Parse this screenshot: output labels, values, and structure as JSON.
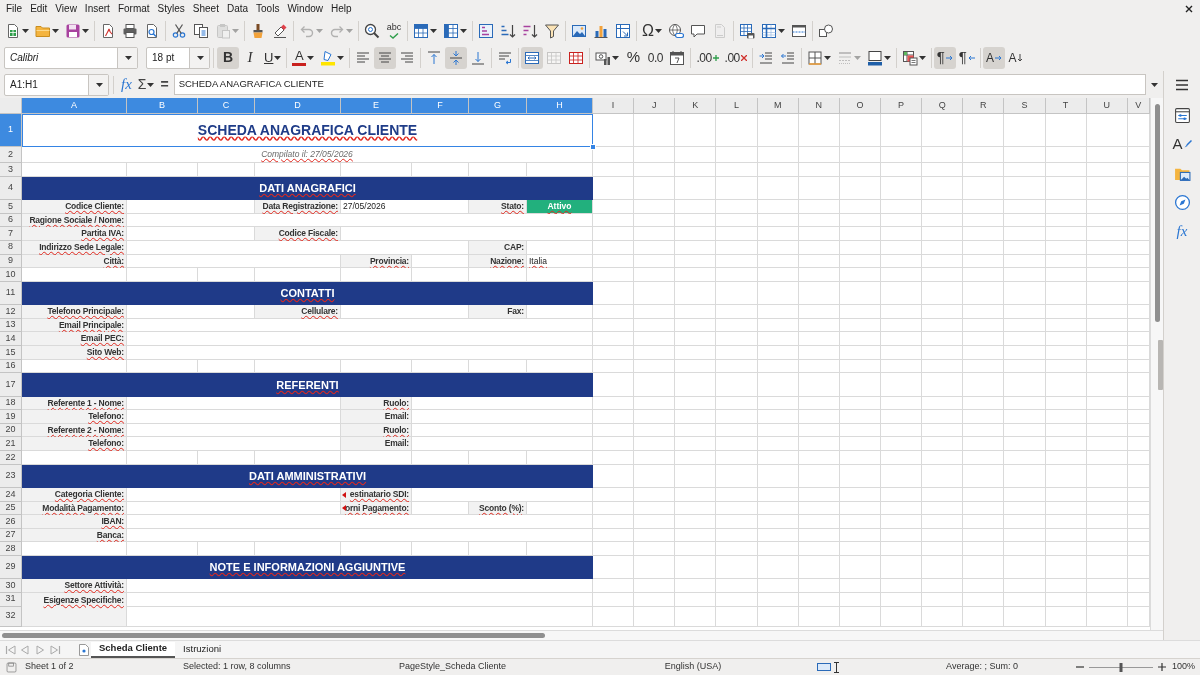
{
  "menu_bar": {
    "items": [
      "File",
      "Edit",
      "View",
      "Insert",
      "Format",
      "Styles",
      "Sheet",
      "Data",
      "Tools",
      "Window",
      "Help"
    ]
  },
  "standard_toolbar": {
    "groups": [
      [
        {
          "kind": "new",
          "disabled": false
        },
        {
          "kind": "open",
          "disabled": false
        },
        {
          "kind": "save",
          "disabled": false
        }
      ],
      [
        {
          "kind": "export_pdf",
          "disabled": false
        },
        {
          "kind": "print",
          "disabled": false
        },
        {
          "kind": "print_preview",
          "disabled": false
        }
      ],
      [
        {
          "kind": "cut",
          "disabled": false
        },
        {
          "kind": "copy",
          "disabled": false
        },
        {
          "kind": "paste",
          "disabled": true
        }
      ],
      [
        {
          "kind": "clone_formatting",
          "disabled": false
        },
        {
          "kind": "clear_formatting",
          "disabled": false
        }
      ],
      [
        {
          "kind": "undo",
          "disabled": true
        },
        {
          "kind": "redo",
          "disabled": true
        }
      ],
      [
        {
          "kind": "find_replace",
          "disabled": false
        },
        {
          "kind": "spelling",
          "glyph": "abc",
          "disabled": false
        }
      ],
      [
        {
          "kind": "rows",
          "disabled": false
        },
        {
          "kind": "columns",
          "disabled": false
        }
      ],
      [
        {
          "kind": "sort",
          "disabled": false
        },
        {
          "kind": "sort_ascending",
          "disabled": false
        },
        {
          "kind": "sort_descending",
          "disabled": false
        },
        {
          "kind": "autofilter",
          "disabled": false
        }
      ],
      [
        {
          "kind": "image",
          "disabled": false
        },
        {
          "kind": "chart",
          "disabled": false
        },
        {
          "kind": "pivot_table",
          "disabled": false
        }
      ],
      [
        {
          "kind": "special_character",
          "glyph": "Ω",
          "disabled": false
        },
        {
          "kind": "hyperlink",
          "disabled": false
        },
        {
          "kind": "comment",
          "disabled": false
        },
        {
          "kind": "headers_footers",
          "disabled": true
        }
      ],
      [
        {
          "kind": "print_area",
          "disabled": false
        },
        {
          "kind": "freeze",
          "disabled": false
        },
        {
          "kind": "split",
          "disabled": false
        }
      ],
      [
        {
          "kind": "draw",
          "disabled": false
        }
      ]
    ]
  },
  "formatting_toolbar": {
    "font_name": "Calibri",
    "font_size": "18 pt",
    "groups": [
      [
        {
          "kind": "bold",
          "glyph": "B",
          "on": true,
          "disabled": false
        },
        {
          "kind": "italic",
          "glyph": "I",
          "on": false,
          "disabled": false
        },
        {
          "kind": "underline",
          "glyph": "U",
          "on": false,
          "disabled": false
        }
      ],
      [
        {
          "kind": "font_color",
          "glyph": "A",
          "on": false,
          "disabled": false
        },
        {
          "kind": "highlight",
          "on": false,
          "disabled": false
        }
      ],
      [
        {
          "kind": "align_left",
          "on": false,
          "disabled": false
        },
        {
          "kind": "align_center",
          "on": true,
          "disabled": false
        },
        {
          "kind": "align_right",
          "on": false,
          "disabled": false
        }
      ],
      [
        {
          "kind": "align_top",
          "on": false,
          "disabled": false
        },
        {
          "kind": "align_middle",
          "on": true,
          "disabled": false
        },
        {
          "kind": "align_bottom",
          "on": false,
          "disabled": false
        }
      ],
      [
        {
          "kind": "wrap",
          "on": false,
          "disabled": false
        }
      ],
      [
        {
          "kind": "merge_center",
          "on": true,
          "disabled": false
        },
        {
          "kind": "merge",
          "on": false,
          "disabled": true
        },
        {
          "kind": "unmerge",
          "on": false,
          "disabled": false
        }
      ],
      [
        {
          "kind": "number_format",
          "on": false,
          "disabled": false
        },
        {
          "kind": "percent",
          "glyph": "%",
          "on": false,
          "disabled": false
        },
        {
          "kind": "number",
          "glyph": "0.0",
          "on": false,
          "disabled": false
        },
        {
          "kind": "date",
          "on": false,
          "disabled": false
        }
      ],
      [
        {
          "kind": "add_decimal",
          "glyph": ".00",
          "on": false,
          "disabled": false
        },
        {
          "kind": "delete_decimal",
          "glyph": ".00",
          "on": false,
          "disabled": false
        }
      ],
      [
        {
          "kind": "indent_increase",
          "on": false,
          "disabled": false
        },
        {
          "kind": "indent_decrease",
          "on": false,
          "disabled": false
        }
      ],
      [
        {
          "kind": "borders",
          "on": false,
          "disabled": false
        },
        {
          "kind": "border_style",
          "on": false,
          "disabled": true
        },
        {
          "kind": "border_color",
          "on": false,
          "disabled": false
        }
      ],
      [
        {
          "kind": "conditional",
          "on": false,
          "disabled": false
        }
      ],
      [
        {
          "kind": "paragraph_ltr",
          "glyph": "¶",
          "on": true,
          "disabled": false
        },
        {
          "kind": "paragraph_rtl",
          "glyph": "¶",
          "on": false,
          "disabled": false
        }
      ],
      [
        {
          "kind": "text_ltr",
          "glyph": "A",
          "on": true,
          "disabled": false
        },
        {
          "kind": "text_ttb",
          "glyph": "A",
          "on": false,
          "disabled": false
        }
      ]
    ]
  },
  "formula_bar": {
    "name_box": "A1:H1",
    "function_wizard": "fx",
    "sum": "Σ",
    "equals": "=",
    "content": "SCHEDA ANAGRAFICA CLIENTE"
  },
  "sidebar": {
    "tabs": [
      {
        "kind": "properties",
        "selected": false
      },
      {
        "kind": "styles",
        "glyph": "A",
        "selected": false
      },
      {
        "kind": "gallery",
        "selected": false
      },
      {
        "kind": "navigator",
        "selected": false
      },
      {
        "kind": "functions",
        "glyph": "fx",
        "selected": false
      }
    ]
  },
  "sheet": {
    "columns": [
      {
        "label": "A",
        "selected": true
      },
      {
        "label": "B",
        "selected": true
      },
      {
        "label": "C",
        "selected": true
      },
      {
        "label": "D",
        "selected": true
      },
      {
        "label": "E",
        "selected": true
      },
      {
        "label": "F",
        "selected": true
      },
      {
        "label": "G",
        "selected": true
      },
      {
        "label": "H",
        "selected": true
      },
      {
        "label": "I",
        "selected": false
      },
      {
        "label": "J",
        "selected": false
      },
      {
        "label": "K",
        "selected": false
      },
      {
        "label": "L",
        "selected": false
      },
      {
        "label": "M",
        "selected": false
      },
      {
        "label": "N",
        "selected": false
      },
      {
        "label": "O",
        "selected": false
      },
      {
        "label": "P",
        "selected": false
      },
      {
        "label": "Q",
        "selected": false
      },
      {
        "label": "R",
        "selected": false
      },
      {
        "label": "S",
        "selected": false
      },
      {
        "label": "T",
        "selected": false
      },
      {
        "label": "U",
        "selected": false
      },
      {
        "label": "V",
        "selected": false
      }
    ],
    "rows": [
      {
        "number": "1",
        "selected": true,
        "kind": "title",
        "text": "SCHEDA ANAGRAFICA CLIENTE",
        "flagged": true
      },
      {
        "number": "2",
        "selected": false,
        "kind": "subtitle",
        "text": "Compilato il: 27/05/2026",
        "flagged": true
      },
      {
        "number": "3",
        "selected": false,
        "kind": "blank"
      },
      {
        "number": "4",
        "selected": false,
        "kind": "section",
        "text": "DATI ANAGRAFICI",
        "flagged": true
      },
      {
        "number": "5",
        "selected": false,
        "kind": "fields",
        "fields": [
          {
            "label": "Codice Cliente:",
            "flagged": true,
            "overflow": false
          },
          {
            "label": "Data Registrazione:",
            "flagged": true,
            "overflow": false,
            "value": {
              "text": "27/05/2026",
              "flagged": false
            }
          },
          {
            "label": "Stato:",
            "flagged": true,
            "overflow": false,
            "value": {
              "text": "Attivo",
              "flagged": true,
              "color": "#22b07d"
            }
          }
        ]
      },
      {
        "number": "6",
        "selected": false,
        "kind": "fields",
        "fields": [
          {
            "label": "Ragione Sociale / Nome:",
            "flagged": true,
            "overflow": false
          }
        ]
      },
      {
        "number": "7",
        "selected": false,
        "kind": "fields",
        "fields": [
          {
            "label": "Partita IVA:",
            "flagged": true,
            "overflow": false
          },
          {
            "label": "Codice Fiscale:",
            "flagged": true,
            "overflow": false
          }
        ]
      },
      {
        "number": "8",
        "selected": false,
        "kind": "fields",
        "fields": [
          {
            "label": "Indirizzo Sede Legale:",
            "flagged": true,
            "overflow": false
          },
          {
            "label": "CAP:",
            "flagged": false,
            "overflow": false
          }
        ]
      },
      {
        "number": "9",
        "selected": false,
        "kind": "fields",
        "fields": [
          {
            "label": "Città:",
            "flagged": true,
            "overflow": false
          },
          {
            "label": "Provincia:",
            "flagged": true,
            "overflow": false
          },
          {
            "label": "Nazione:",
            "flagged": true,
            "overflow": false,
            "value": {
              "text": "Italia",
              "flagged": true
            }
          }
        ]
      },
      {
        "number": "10",
        "selected": false,
        "kind": "blank"
      },
      {
        "number": "11",
        "selected": false,
        "kind": "section",
        "text": "CONTATTI",
        "flagged": true
      },
      {
        "number": "12",
        "selected": false,
        "kind": "fields",
        "fields": [
          {
            "label": "Telefono Principale:",
            "flagged": true,
            "overflow": false
          },
          {
            "label": "Cellulare:",
            "flagged": true,
            "overflow": false
          },
          {
            "label": "Fax:",
            "flagged": false,
            "overflow": false
          }
        ]
      },
      {
        "number": "13",
        "selected": false,
        "kind": "fields",
        "fields": [
          {
            "label": "Email Principale:",
            "flagged": true,
            "overflow": false
          }
        ]
      },
      {
        "number": "14",
        "selected": false,
        "kind": "fields",
        "fields": [
          {
            "label": "Email PEC:",
            "flagged": true,
            "overflow": false
          }
        ]
      },
      {
        "number": "15",
        "selected": false,
        "kind": "fields",
        "fields": [
          {
            "label": "Sito Web:",
            "flagged": true,
            "overflow": false
          }
        ]
      },
      {
        "number": "16",
        "selected": false,
        "kind": "blank"
      },
      {
        "number": "17",
        "selected": false,
        "kind": "section",
        "text": "REFERENTI",
        "flagged": true
      },
      {
        "number": "18",
        "selected": false,
        "kind": "fields",
        "fields": [
          {
            "label": "Referente 1 - Nome:",
            "flagged": true,
            "overflow": false
          },
          {
            "label": "Ruolo:",
            "flagged": true,
            "overflow": false
          }
        ]
      },
      {
        "number": "19",
        "selected": false,
        "kind": "fields",
        "fields": [
          {
            "label": "Telefono:",
            "flagged": true,
            "overflow": false
          },
          {
            "label": "Email:",
            "flagged": false,
            "overflow": false
          }
        ]
      },
      {
        "number": "20",
        "selected": false,
        "kind": "fields",
        "fields": [
          {
            "label": "Referente 2 - Nome:",
            "flagged": true,
            "overflow": false
          },
          {
            "label": "Ruolo:",
            "flagged": true,
            "overflow": false
          }
        ]
      },
      {
        "number": "21",
        "selected": false,
        "kind": "fields",
        "fields": [
          {
            "label": "Telefono:",
            "flagged": true,
            "overflow": false
          },
          {
            "label": "Email:",
            "flagged": false,
            "overflow": false
          }
        ]
      },
      {
        "number": "22",
        "selected": false,
        "kind": "blank"
      },
      {
        "number": "23",
        "selected": false,
        "kind": "section",
        "text": "DATI AMMINISTRATIVI",
        "flagged": true
      },
      {
        "number": "24",
        "selected": false,
        "kind": "fields",
        "fields": [
          {
            "label": "Categoria Cliente:",
            "flagged": true,
            "overflow": false
          },
          {
            "label": "estinatario SDI:",
            "flagged": true,
            "overflow": true
          }
        ]
      },
      {
        "number": "25",
        "selected": false,
        "kind": "fields",
        "fields": [
          {
            "label": "Modalità Pagamento:",
            "flagged": true,
            "overflow": false
          },
          {
            "label": "orni Pagamento:",
            "flagged": true,
            "overflow": true
          },
          {
            "label": "Sconto (%):",
            "flagged": true,
            "overflow": false
          }
        ]
      },
      {
        "number": "26",
        "selected": false,
        "kind": "fields",
        "fields": [
          {
            "label": "IBAN:",
            "flagged": true,
            "overflow": false
          }
        ]
      },
      {
        "number": "27",
        "selected": false,
        "kind": "fields",
        "fields": [
          {
            "label": "Banca:",
            "flagged": true,
            "overflow": false
          }
        ]
      },
      {
        "number": "28",
        "selected": false,
        "kind": "blank"
      },
      {
        "number": "29",
        "selected": false,
        "kind": "section",
        "text": "NOTE E INFORMAZIONI AGGIUNTIVE",
        "flagged": true
      },
      {
        "number": "30",
        "selected": false,
        "kind": "fields",
        "fields": [
          {
            "label": "Settore Attività:",
            "flagged": true,
            "overflow": false
          }
        ]
      },
      {
        "number": "31",
        "selected": false,
        "kind": "fields",
        "fields": [
          {
            "label": "Esigenze Specifiche:",
            "flagged": true,
            "overflow": false
          }
        ]
      },
      {
        "number": "32",
        "selected": false,
        "kind": "continued"
      }
    ]
  },
  "sheet_tabs": [
    {
      "label": "Scheda Cliente",
      "selected": true
    },
    {
      "label": "Istruzioni",
      "selected": false
    }
  ],
  "status_bar": {
    "sheet": "Sheet 1 of 2",
    "selection": "Selected: 1 row, 8 columns",
    "page_style": "PageStyle_Scheda Cliente",
    "language": "English (USA)",
    "summary": "Average: ; Sum: 0",
    "zoom": {
      "level": 0.5,
      "label": "100%"
    }
  }
}
